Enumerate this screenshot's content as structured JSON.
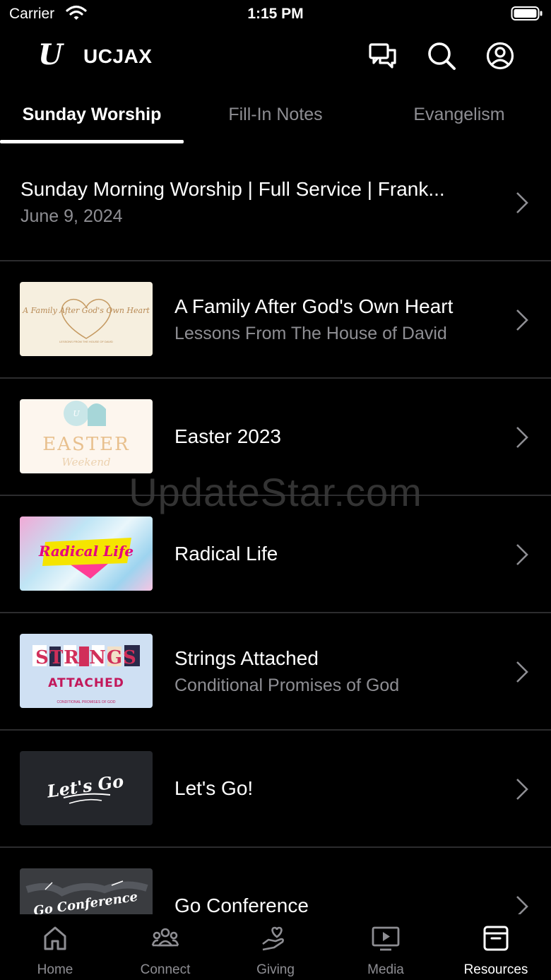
{
  "status_bar": {
    "carrier": "Carrier",
    "time": "1:15 PM"
  },
  "header": {
    "logo": "U",
    "title": "UCJAX"
  },
  "tabs": [
    {
      "label": "Sunday Worship",
      "active": true
    },
    {
      "label": "Fill-In Notes",
      "active": false
    },
    {
      "label": "Evangelism",
      "active": false
    }
  ],
  "items": [
    {
      "title": "Sunday Morning Worship | Full Service | Frank...",
      "subtitle": "June 9, 2024"
    },
    {
      "title": "A Family After God's Own Heart",
      "subtitle": "Lessons From The House of David",
      "thumb": "A Family After God's Own Heart",
      "thumb_caption": "LESSONS FROM THE HOUSE OF DAVID"
    },
    {
      "title": "Easter 2023",
      "thumb": "EASTER",
      "thumb_script": "Weekend"
    },
    {
      "title": "Radical Life",
      "thumb": "Radical Life"
    },
    {
      "title": "Strings Attached",
      "subtitle": "Conditional Promises of God",
      "thumb_top": "STRINGS",
      "thumb_mid": "ATTACHED",
      "thumb_caption": "CONDITIONAL PROMISES OF GOD"
    },
    {
      "title": "Let's Go!",
      "thumb": "Let's Go"
    },
    {
      "title": "Go Conference",
      "thumb": "Go Conference"
    }
  ],
  "watermark": "UpdateStar.com",
  "tab_bar": [
    {
      "label": "Home",
      "icon": "home-icon",
      "active": false
    },
    {
      "label": "Connect",
      "icon": "connect-icon",
      "active": false
    },
    {
      "label": "Giving",
      "icon": "giving-icon",
      "active": false
    },
    {
      "label": "Media",
      "icon": "media-icon",
      "active": false
    },
    {
      "label": "Resources",
      "icon": "resources-icon",
      "active": true
    }
  ],
  "colors": {
    "background": "#000000",
    "secondary_text": "#8e8e93",
    "divider": "#2c2c2e"
  }
}
